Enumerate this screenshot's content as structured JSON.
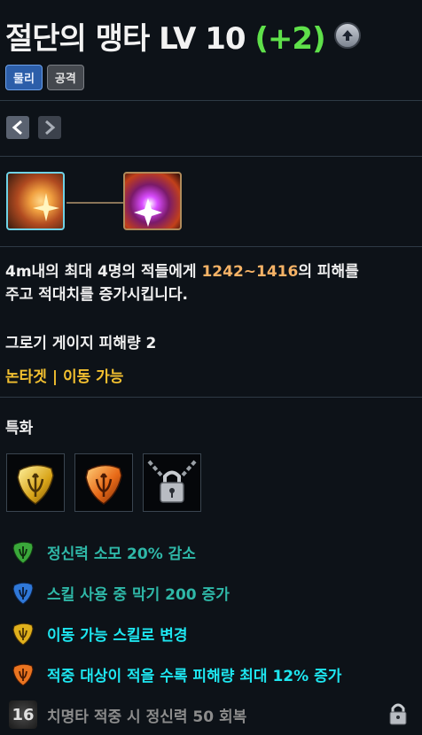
{
  "skill": {
    "name": "절단의 맹타",
    "level_label": "LV 10",
    "bonus": "(+2)"
  },
  "tags": [
    "물리",
    "공격"
  ],
  "description": {
    "part1": "4m내의 최대 4명의 적들에게 ",
    "damage": "1242~1416",
    "part2": "의 피해를",
    "line2": "주고 적대치를 증가시킵니다."
  },
  "stagger": "그로기 게이지 피해량 2",
  "properties": "논타겟 | 이동 가능",
  "specialization_label": "특화",
  "effects": [
    {
      "text": "정신력 소모 20% 감소",
      "color": "#2fb8a8",
      "icon": "green-rune-icon"
    },
    {
      "text": "스킬 사용 중 막기 200 증가",
      "color": "#2fb8a8",
      "icon": "blue-rune-icon"
    },
    {
      "text": "이동 가능 스킬로 변경",
      "color": "#1ee6f0",
      "icon": "gold-rune-icon"
    },
    {
      "text": "적중 대상이 적을 수록 피해량 최대 12% 증가",
      "color": "#1ee6f0",
      "icon": "orange-rune-icon"
    },
    {
      "text": "치명타 적중 시 정신력 50 회복",
      "color": "#8c8c8c",
      "icon": "level-lock-icon",
      "level": "16"
    }
  ],
  "colors": {
    "bonus": "#5fe04a",
    "damage": "#f5b266",
    "properties": "#f3c030"
  }
}
